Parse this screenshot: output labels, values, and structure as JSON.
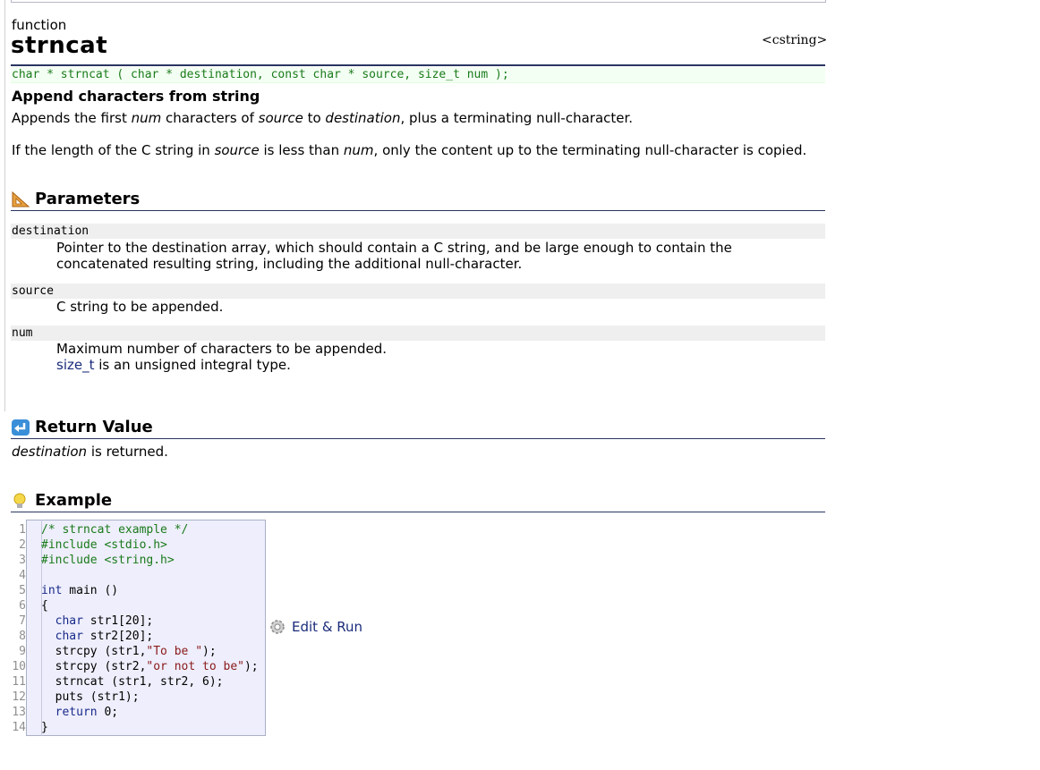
{
  "kind_label": "function",
  "title": "strncat",
  "header_lib": "<cstring>",
  "prototype": "char * strncat ( char * destination, const char * source, size_t num );",
  "subtitle": "Append characters from string",
  "desc": {
    "p1_a": "Appends the first ",
    "p1_num": "num",
    "p1_b": " characters of ",
    "p1_source": "source",
    "p1_c": " to ",
    "p1_dest": "destination",
    "p1_d": ", plus a terminating null-character.",
    "p2_a": "If the length of the C string in ",
    "p2_source": "source",
    "p2_b": " is less than ",
    "p2_num": "num",
    "p2_c": ", only the content up to the terminating null-character is copied."
  },
  "parameters": {
    "heading": "Parameters",
    "items": [
      {
        "name": "destination",
        "desc_line1": "Pointer to the destination array, which should contain a C string, and be large enough to contain the",
        "desc_line2": "concatenated resulting string, including the additional null-character."
      },
      {
        "name": "source",
        "desc_line1": "C string to be appended."
      },
      {
        "name": "num",
        "desc_line1": "Maximum number of characters to be appended.",
        "link": "size_t",
        "desc_line2_rest": " is an unsigned integral type."
      }
    ]
  },
  "return_value": {
    "heading": "Return Value",
    "dest": "destination",
    "rest": " is returned."
  },
  "example": {
    "heading": "Example",
    "line_numbers": [
      "1",
      "2",
      "3",
      "4",
      "5",
      "6",
      "7",
      "8",
      "9",
      "10",
      "11",
      "12",
      "13",
      "14"
    ],
    "edit_run_label": "Edit & Run"
  },
  "colors": {
    "heading_rule": "#2a3560",
    "prototype_text": "#1a7a1a",
    "link": "#1a2b7a",
    "code_bg": "#eeeefc"
  }
}
